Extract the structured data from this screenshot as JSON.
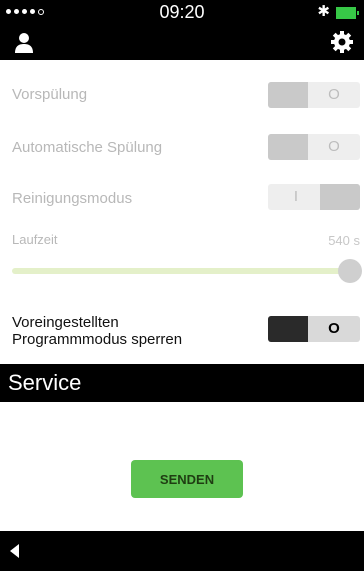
{
  "status_bar": {
    "time": "09:20"
  },
  "settings": [
    {
      "label": "Vorspülung",
      "state": "O"
    },
    {
      "label": "Automatische Spülung",
      "state": "O"
    },
    {
      "label": "Reinigungsmodus",
      "state": "I"
    }
  ],
  "runtime": {
    "label": "Laufzeit",
    "value": "540 s",
    "fill_percent": 100
  },
  "lock_setting": {
    "label_line1": "Voreingestellten",
    "label_line2": "Programmmodus sperren",
    "state": "O"
  },
  "service": {
    "title": "Service",
    "send_label": "SENDEN"
  },
  "colors": {
    "accent": "#5dc251",
    "bar_background": "#000000"
  },
  "icons": [
    "user-icon",
    "gear-icon",
    "back-icon",
    "bluetooth-icon",
    "battery-icon"
  ]
}
